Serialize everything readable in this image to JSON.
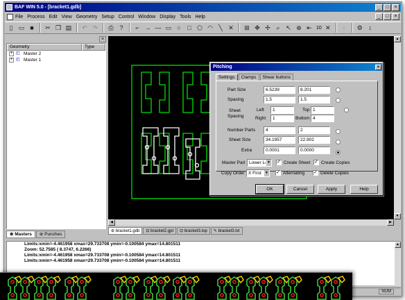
{
  "window": {
    "title": "BAF WIN 5.0 - [bracket1.gdb]",
    "controls": [
      "_",
      "□",
      "×"
    ]
  },
  "menu": {
    "items": [
      "File",
      "Process",
      "Edit",
      "View",
      "Geometry",
      "Setup",
      "Control",
      "Window",
      "Display",
      "Tools",
      "Help"
    ],
    "mdi_controls": [
      "_",
      "□",
      "×"
    ]
  },
  "toolbar": {
    "zoom_value": "10"
  },
  "tree": {
    "columns": [
      "Geometry",
      "Type"
    ],
    "rows": [
      {
        "expander": "+",
        "label": "Master 2"
      },
      {
        "expander": "+",
        "label": "Master 1"
      }
    ],
    "close_glyph": "×"
  },
  "left_tabs": [
    "Masters",
    "Punches"
  ],
  "doc_tabs": [
    "bracket1.gdb",
    "bracket2.gpt",
    "bracket3.top",
    "bracket3.txt"
  ],
  "dialog": {
    "title": "Pitching",
    "close_glyph": "×",
    "tabs": [
      "Settings",
      "Clamps",
      "Shear buttons"
    ],
    "part_size": {
      "label": "Part Size",
      "x": "6.5239",
      "y": "8.201"
    },
    "spacing": {
      "label": "Spacing",
      "x": "1.5",
      "y": "1.5"
    },
    "sheet_spacing": {
      "label_line1": "Sheet",
      "label_line2": "Spacing",
      "left_label": "Left",
      "left": "1",
      "right_label": "Right",
      "right": "1",
      "top_label": "Top",
      "top": "1",
      "bottom_label": "Bottom",
      "bottom": "4"
    },
    "number_parts": {
      "label": "Number Parts",
      "x": "4",
      "y": "2"
    },
    "sheet_size": {
      "label": "Sheet Size",
      "x": "34.1957",
      "y": "22.902"
    },
    "extra": {
      "label": "Extra",
      "x": "0.0001",
      "y": "0.0000"
    },
    "master_part": {
      "label": "Master Part",
      "value": "Lower Left"
    },
    "copy_order": {
      "label": "Copy Order",
      "value": "X First"
    },
    "checkboxes": {
      "create_sheet": {
        "label": "Create Sheet",
        "checked": true
      },
      "create_copies": {
        "label": "Create Copies",
        "checked": true
      },
      "alternating": {
        "label": "Alternating",
        "checked": true
      },
      "delete_copies": {
        "label": "Delete Copies",
        "checked": true
      }
    },
    "buttons": {
      "ok": "OK",
      "cancel": "Cancel",
      "apply": "Apply",
      "help": "Help"
    }
  },
  "console": {
    "lines": [
      "Limits:xmin=-4.461958 xmax=29.733708 ymin=-0.100584 ymax=14.801511",
      "Zoom: 52.7585 ( 8.3747, 6.2266)",
      "Limits:xmin=-4.461958 xmax=29.733708 ymin=-0.100584 ymax=14.801511",
      "Limits:xmin=-4.461958 xmax=29.733708 ymin=-0.100584 ymax=14.801511"
    ]
  },
  "status": {
    "indicator": "NUM"
  },
  "colors": {
    "part_outline": "#00e000",
    "part_punch": "#ffffff",
    "strip_part": "#3cc83c",
    "strip_hole": "#ff2020",
    "strip_punch": "#ffd400",
    "title_bar": "#000080"
  }
}
